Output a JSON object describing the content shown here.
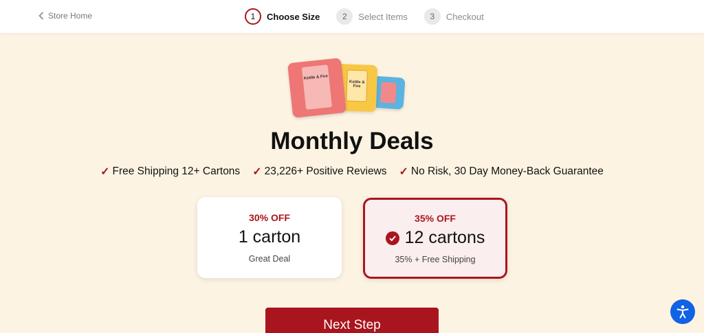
{
  "header": {
    "back_label": "Store Home",
    "steps": [
      {
        "num": "1",
        "label": "Choose Size",
        "state": "active"
      },
      {
        "num": "2",
        "label": "Select Items",
        "state": "inactive"
      },
      {
        "num": "3",
        "label": "Checkout",
        "state": "inactive"
      }
    ]
  },
  "hero": {
    "brand_text": "Kettle & Fire"
  },
  "main": {
    "title": "Monthly Deals",
    "benefits": [
      "Free Shipping 12+ Cartons",
      "23,226+ Positive Reviews",
      "No Risk, 30 Day Money-Back Guarantee"
    ],
    "options": [
      {
        "discount": "30% OFF",
        "size": "1 carton",
        "desc": "Great Deal",
        "selected": false
      },
      {
        "discount": "35% OFF",
        "size": "12 cartons",
        "desc": "35% + Free Shipping",
        "selected": true
      }
    ],
    "next_label": "Next Step"
  },
  "colors": {
    "accent": "#a9151e",
    "background": "#fdf3e3",
    "accessibility": "#1163e4"
  },
  "icons": {
    "back": "chevron-left-icon",
    "check": "check-icon",
    "selected": "check-circle-icon",
    "accessibility": "accessibility-icon"
  }
}
